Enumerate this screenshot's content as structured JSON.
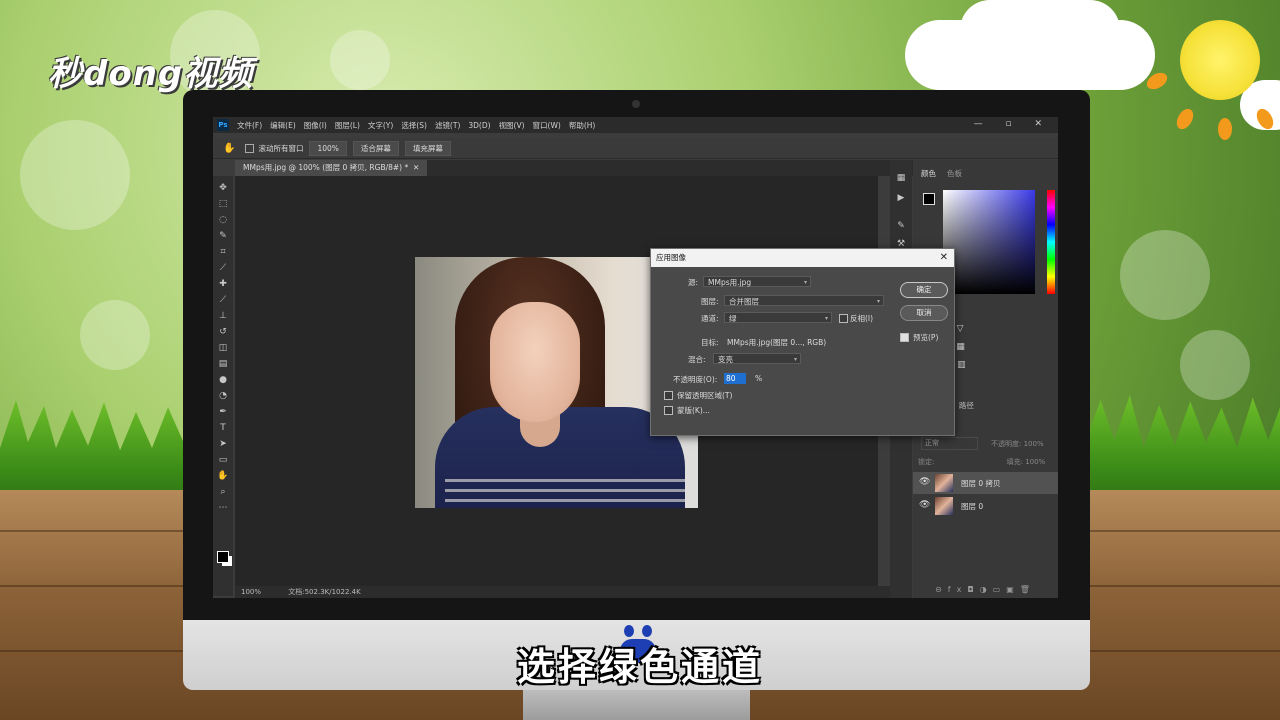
{
  "logo": {
    "text": "秒dong视频"
  },
  "subtitle": {
    "text": "选择绿色通道"
  },
  "photoshop": {
    "ps_icon": "Ps",
    "menu": [
      "文件(F)",
      "编辑(E)",
      "图像(I)",
      "图层(L)",
      "文字(Y)",
      "选择(S)",
      "滤镜(T)",
      "3D(D)",
      "视图(V)",
      "窗口(W)",
      "帮助(H)"
    ],
    "window_controls": "—  ▫  ✕",
    "options": {
      "scroll_all": "滚动所有窗口",
      "zoom_100": "100%",
      "fit_screen": "适合屏幕",
      "fill_screen": "填充屏幕"
    },
    "doc_tab": "MMps用.jpg @ 100% (图层 0 拷贝, RGB/8#) *",
    "status": {
      "zoom": "100%",
      "doc": "文档:502.3K/1022.4K"
    },
    "color_panel": {
      "tab1": "颜色",
      "tab2": "色板"
    },
    "layers_panel": {
      "tab_channels": "道",
      "tab_paths": "路径",
      "blend_mode": "正常",
      "opacity_label": "不透明度:",
      "opacity_value": "100%",
      "lock_label": "锁定:",
      "fill_label": "填充:",
      "fill_value": "100%",
      "layers": [
        {
          "name": "图层 0 拷贝",
          "selected": true
        },
        {
          "name": "图层 0",
          "selected": false
        }
      ]
    }
  },
  "dialog": {
    "title": "应用图像",
    "source_label": "源:",
    "source_value": "MMps用.jpg",
    "layer_label": "图层:",
    "layer_value": "合并图层",
    "channel_label": "通道:",
    "channel_value": "绿",
    "invert_label": "反相(I)",
    "target_label": "目标:",
    "target_value": "MMps用.jpg(图层 0..., RGB)",
    "blending_label": "混合:",
    "blending_value": "变亮",
    "opacity_label": "不透明度(O):",
    "opacity_value": "80",
    "percent": "%",
    "preserve_label": "保留透明区域(T)",
    "mask_label": "蒙版(K)...",
    "ok_label": "确定",
    "cancel_label": "取消",
    "preview_label": "预览(P)"
  }
}
